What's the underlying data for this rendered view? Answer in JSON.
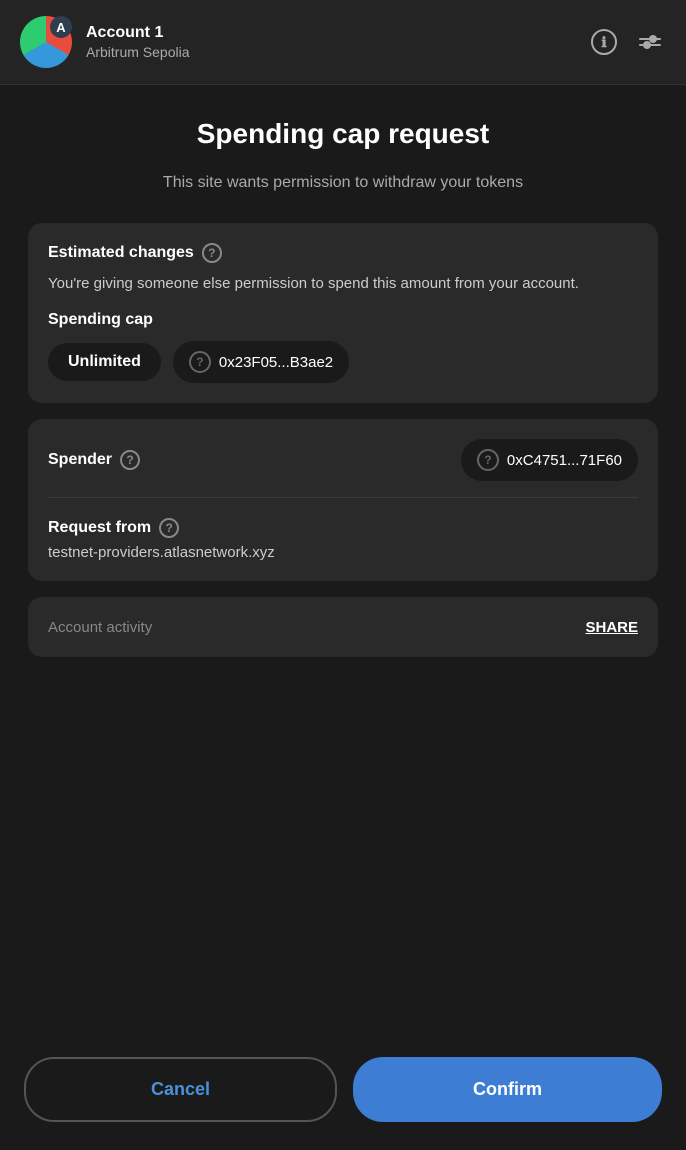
{
  "header": {
    "avatar_letter": "A",
    "account_name": "Account 1",
    "network_name": "Arbitrum Sepolia"
  },
  "page": {
    "title": "Spending cap request",
    "subtitle": "This site wants permission to withdraw your tokens"
  },
  "estimated_changes_card": {
    "section_title": "Estimated changes",
    "description": "You're giving someone else permission to spend this amount from your account.",
    "spending_cap_label": "Spending cap",
    "spending_cap_value": "Unlimited",
    "token_address": "0x23F05...B3ae2"
  },
  "spender_card": {
    "spender_label": "Spender",
    "spender_address": "0xC4751...71F60",
    "request_from_label": "Request from",
    "request_from_url": "testnet-providers.atlasnetwork.xyz"
  },
  "partial_card": {
    "left_text": "Account activity",
    "right_text": "SHARE"
  },
  "footer": {
    "cancel_label": "Cancel",
    "confirm_label": "Confirm"
  },
  "icons": {
    "info": "ℹ",
    "help": "?",
    "sliders": "≡"
  }
}
